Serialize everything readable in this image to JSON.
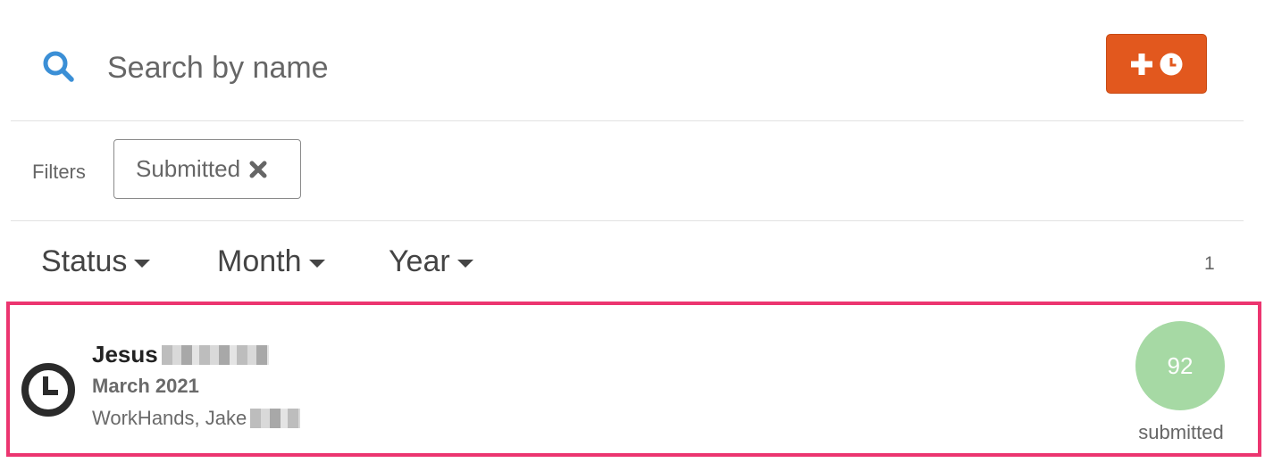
{
  "search": {
    "placeholder": "Search by name",
    "value": "",
    "icon": "search-icon"
  },
  "toolbar": {
    "add_button_icons": [
      "plus-icon",
      "clock-icon"
    ],
    "accent_color": "#e2581e"
  },
  "filters": {
    "label": "Filters",
    "active": [
      {
        "label": "Submitted",
        "remove_icon": "close-icon"
      }
    ]
  },
  "dropdowns": [
    {
      "label": "Status"
    },
    {
      "label": "Month"
    },
    {
      "label": "Year"
    }
  ],
  "result_count": "1",
  "items": [
    {
      "icon": "clock-icon",
      "name": "Jesus",
      "period": "March 2021",
      "meta": "WorkHands, Jake",
      "score": "92",
      "status": "submitted",
      "badge_color": "#a6d9a4",
      "highlight_color": "#ec3570"
    }
  ]
}
